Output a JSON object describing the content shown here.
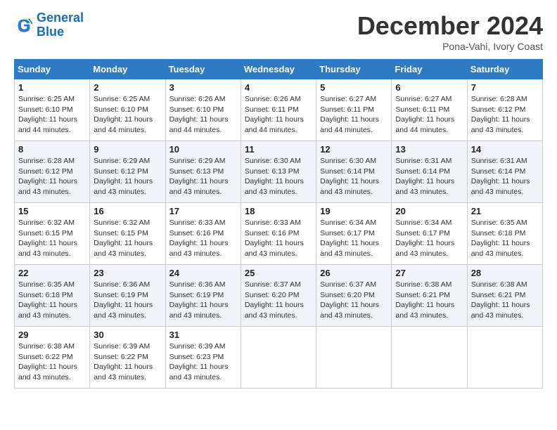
{
  "header": {
    "logo_line1": "General",
    "logo_line2": "Blue",
    "month": "December 2024",
    "location": "Pona-Vahi, Ivory Coast"
  },
  "weekdays": [
    "Sunday",
    "Monday",
    "Tuesday",
    "Wednesday",
    "Thursday",
    "Friday",
    "Saturday"
  ],
  "weeks": [
    [
      {
        "day": "1",
        "sunrise": "6:25 AM",
        "sunset": "6:10 PM",
        "daylight": "11 hours and 44 minutes."
      },
      {
        "day": "2",
        "sunrise": "6:25 AM",
        "sunset": "6:10 PM",
        "daylight": "11 hours and 44 minutes."
      },
      {
        "day": "3",
        "sunrise": "6:26 AM",
        "sunset": "6:10 PM",
        "daylight": "11 hours and 44 minutes."
      },
      {
        "day": "4",
        "sunrise": "6:26 AM",
        "sunset": "6:11 PM",
        "daylight": "11 hours and 44 minutes."
      },
      {
        "day": "5",
        "sunrise": "6:27 AM",
        "sunset": "6:11 PM",
        "daylight": "11 hours and 44 minutes."
      },
      {
        "day": "6",
        "sunrise": "6:27 AM",
        "sunset": "6:11 PM",
        "daylight": "11 hours and 44 minutes."
      },
      {
        "day": "7",
        "sunrise": "6:28 AM",
        "sunset": "6:12 PM",
        "daylight": "11 hours and 43 minutes."
      }
    ],
    [
      {
        "day": "8",
        "sunrise": "6:28 AM",
        "sunset": "6:12 PM",
        "daylight": "11 hours and 43 minutes."
      },
      {
        "day": "9",
        "sunrise": "6:29 AM",
        "sunset": "6:12 PM",
        "daylight": "11 hours and 43 minutes."
      },
      {
        "day": "10",
        "sunrise": "6:29 AM",
        "sunset": "6:13 PM",
        "daylight": "11 hours and 43 minutes."
      },
      {
        "day": "11",
        "sunrise": "6:30 AM",
        "sunset": "6:13 PM",
        "daylight": "11 hours and 43 minutes."
      },
      {
        "day": "12",
        "sunrise": "6:30 AM",
        "sunset": "6:14 PM",
        "daylight": "11 hours and 43 minutes."
      },
      {
        "day": "13",
        "sunrise": "6:31 AM",
        "sunset": "6:14 PM",
        "daylight": "11 hours and 43 minutes."
      },
      {
        "day": "14",
        "sunrise": "6:31 AM",
        "sunset": "6:14 PM",
        "daylight": "11 hours and 43 minutes."
      }
    ],
    [
      {
        "day": "15",
        "sunrise": "6:32 AM",
        "sunset": "6:15 PM",
        "daylight": "11 hours and 43 minutes."
      },
      {
        "day": "16",
        "sunrise": "6:32 AM",
        "sunset": "6:15 PM",
        "daylight": "11 hours and 43 minutes."
      },
      {
        "day": "17",
        "sunrise": "6:33 AM",
        "sunset": "6:16 PM",
        "daylight": "11 hours and 43 minutes."
      },
      {
        "day": "18",
        "sunrise": "6:33 AM",
        "sunset": "6:16 PM",
        "daylight": "11 hours and 43 minutes."
      },
      {
        "day": "19",
        "sunrise": "6:34 AM",
        "sunset": "6:17 PM",
        "daylight": "11 hours and 43 minutes."
      },
      {
        "day": "20",
        "sunrise": "6:34 AM",
        "sunset": "6:17 PM",
        "daylight": "11 hours and 43 minutes."
      },
      {
        "day": "21",
        "sunrise": "6:35 AM",
        "sunset": "6:18 PM",
        "daylight": "11 hours and 43 minutes."
      }
    ],
    [
      {
        "day": "22",
        "sunrise": "6:35 AM",
        "sunset": "6:18 PM",
        "daylight": "11 hours and 43 minutes."
      },
      {
        "day": "23",
        "sunrise": "6:36 AM",
        "sunset": "6:19 PM",
        "daylight": "11 hours and 43 minutes."
      },
      {
        "day": "24",
        "sunrise": "6:36 AM",
        "sunset": "6:19 PM",
        "daylight": "11 hours and 43 minutes."
      },
      {
        "day": "25",
        "sunrise": "6:37 AM",
        "sunset": "6:20 PM",
        "daylight": "11 hours and 43 minutes."
      },
      {
        "day": "26",
        "sunrise": "6:37 AM",
        "sunset": "6:20 PM",
        "daylight": "11 hours and 43 minutes."
      },
      {
        "day": "27",
        "sunrise": "6:38 AM",
        "sunset": "6:21 PM",
        "daylight": "11 hours and 43 minutes."
      },
      {
        "day": "28",
        "sunrise": "6:38 AM",
        "sunset": "6:21 PM",
        "daylight": "11 hours and 43 minutes."
      }
    ],
    [
      {
        "day": "29",
        "sunrise": "6:38 AM",
        "sunset": "6:22 PM",
        "daylight": "11 hours and 43 minutes."
      },
      {
        "day": "30",
        "sunrise": "6:39 AM",
        "sunset": "6:22 PM",
        "daylight": "11 hours and 43 minutes."
      },
      {
        "day": "31",
        "sunrise": "6:39 AM",
        "sunset": "6:23 PM",
        "daylight": "11 hours and 43 minutes."
      },
      null,
      null,
      null,
      null
    ]
  ]
}
